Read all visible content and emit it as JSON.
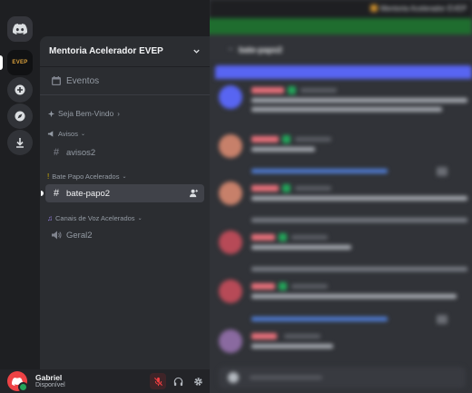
{
  "rail": {
    "server_logo_text": "EVEP",
    "icons": [
      "discord-home-icon",
      "add-server-icon",
      "explore-icon",
      "download-icon"
    ]
  },
  "guild": {
    "name": "Mentoria Acelerador EVEP"
  },
  "channels": {
    "events_label": "Eventos",
    "welcome_category": "Seja Bem-Vindo",
    "avisos_category": "Avisos",
    "avisos_channel": "avisos2",
    "batepapo_category": "Bate Papo Acelerados",
    "active_channel": "bate-papo2",
    "voice_category": "Canais de Voz Acelerados",
    "voice_channel": "Geral2"
  },
  "user": {
    "name": "Gabriel",
    "status": "Disponível"
  },
  "chat": {
    "header_channel": "bate-papo2",
    "top_title": "Mentoria Acelerador EVEP",
    "colors": {
      "accent": "#5865f2",
      "notice": "#1f6d2f",
      "active_channel_bg": "#404249"
    }
  }
}
